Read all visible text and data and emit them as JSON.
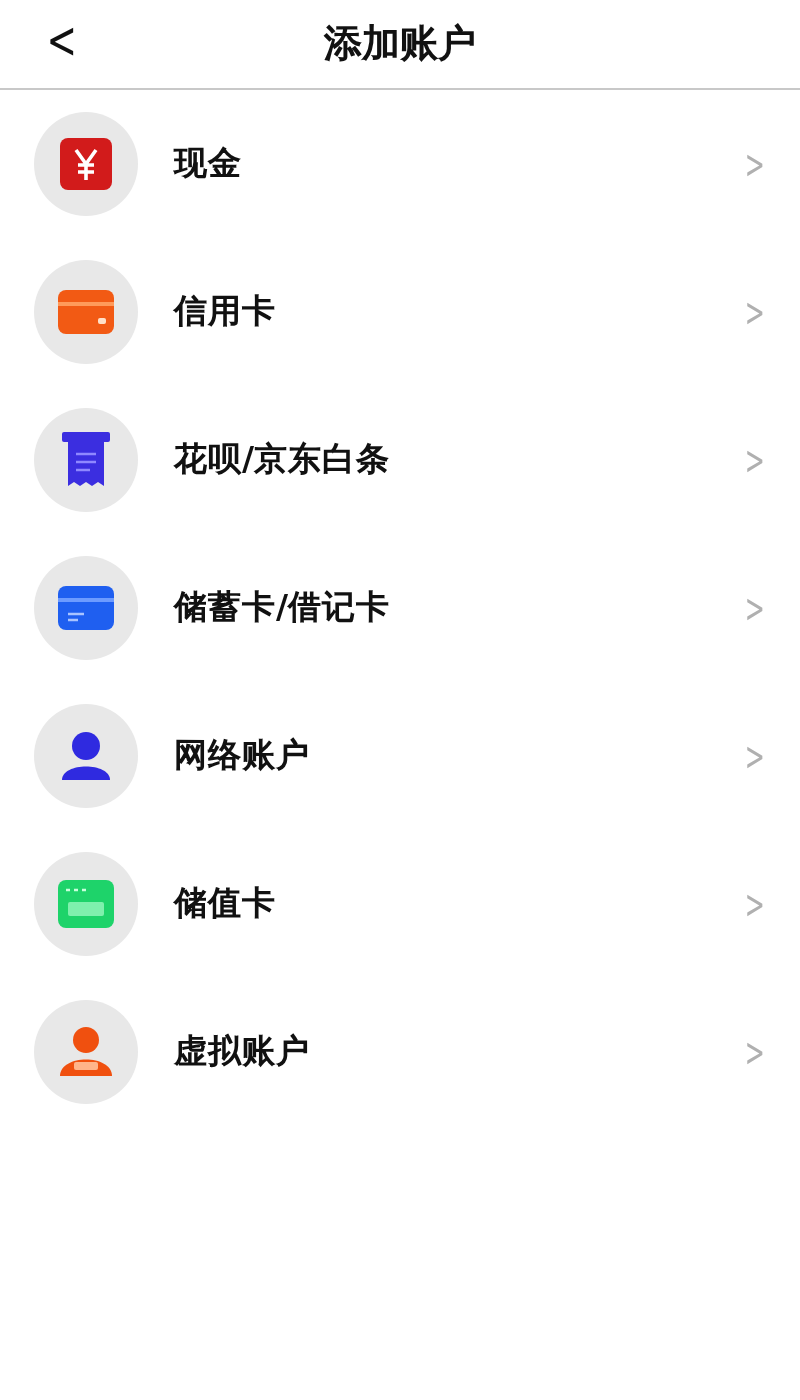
{
  "header": {
    "back": "<",
    "title": "添加账户"
  },
  "accounts": [
    {
      "kind": "cash",
      "label": "现金",
      "chevron": ">"
    },
    {
      "kind": "credit",
      "label": "信用卡",
      "chevron": ">"
    },
    {
      "kind": "bill",
      "label": "花呗/京东白条",
      "chevron": ">"
    },
    {
      "kind": "debit",
      "label": "储蓄卡/借记卡",
      "chevron": ">"
    },
    {
      "kind": "online",
      "label": "网络账户",
      "chevron": ">"
    },
    {
      "kind": "stored",
      "label": "储值卡",
      "chevron": ">"
    },
    {
      "kind": "virtual",
      "label": "虚拟账户",
      "chevron": ">"
    }
  ]
}
